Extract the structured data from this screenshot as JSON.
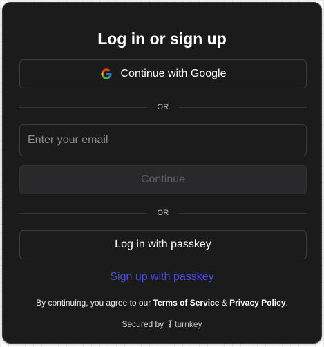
{
  "auth": {
    "title": "Log in or sign up",
    "google_label": "Continue with Google",
    "or_1": "OR",
    "email_placeholder": "Enter your email",
    "email_value": "",
    "continue_label": "Continue",
    "or_2": "OR",
    "passkey_login_label": "Log in with passkey",
    "passkey_signup_label": "Sign up with passkey"
  },
  "footer": {
    "terms_prefix": "By continuing, you agree to our ",
    "terms_link": "Terms of Service",
    "terms_and": " & ",
    "privacy_link": "Privacy Policy",
    "terms_suffix": ".",
    "secured_by": "Secured by",
    "brand": "turnkey"
  },
  "icons": {
    "google": "google-icon",
    "turnkey": "turnkey-key-icon"
  },
  "colors": {
    "card_bg": "#1b1b1c",
    "link": "#4a4ae6",
    "disabled_text": "#5f5f63"
  }
}
